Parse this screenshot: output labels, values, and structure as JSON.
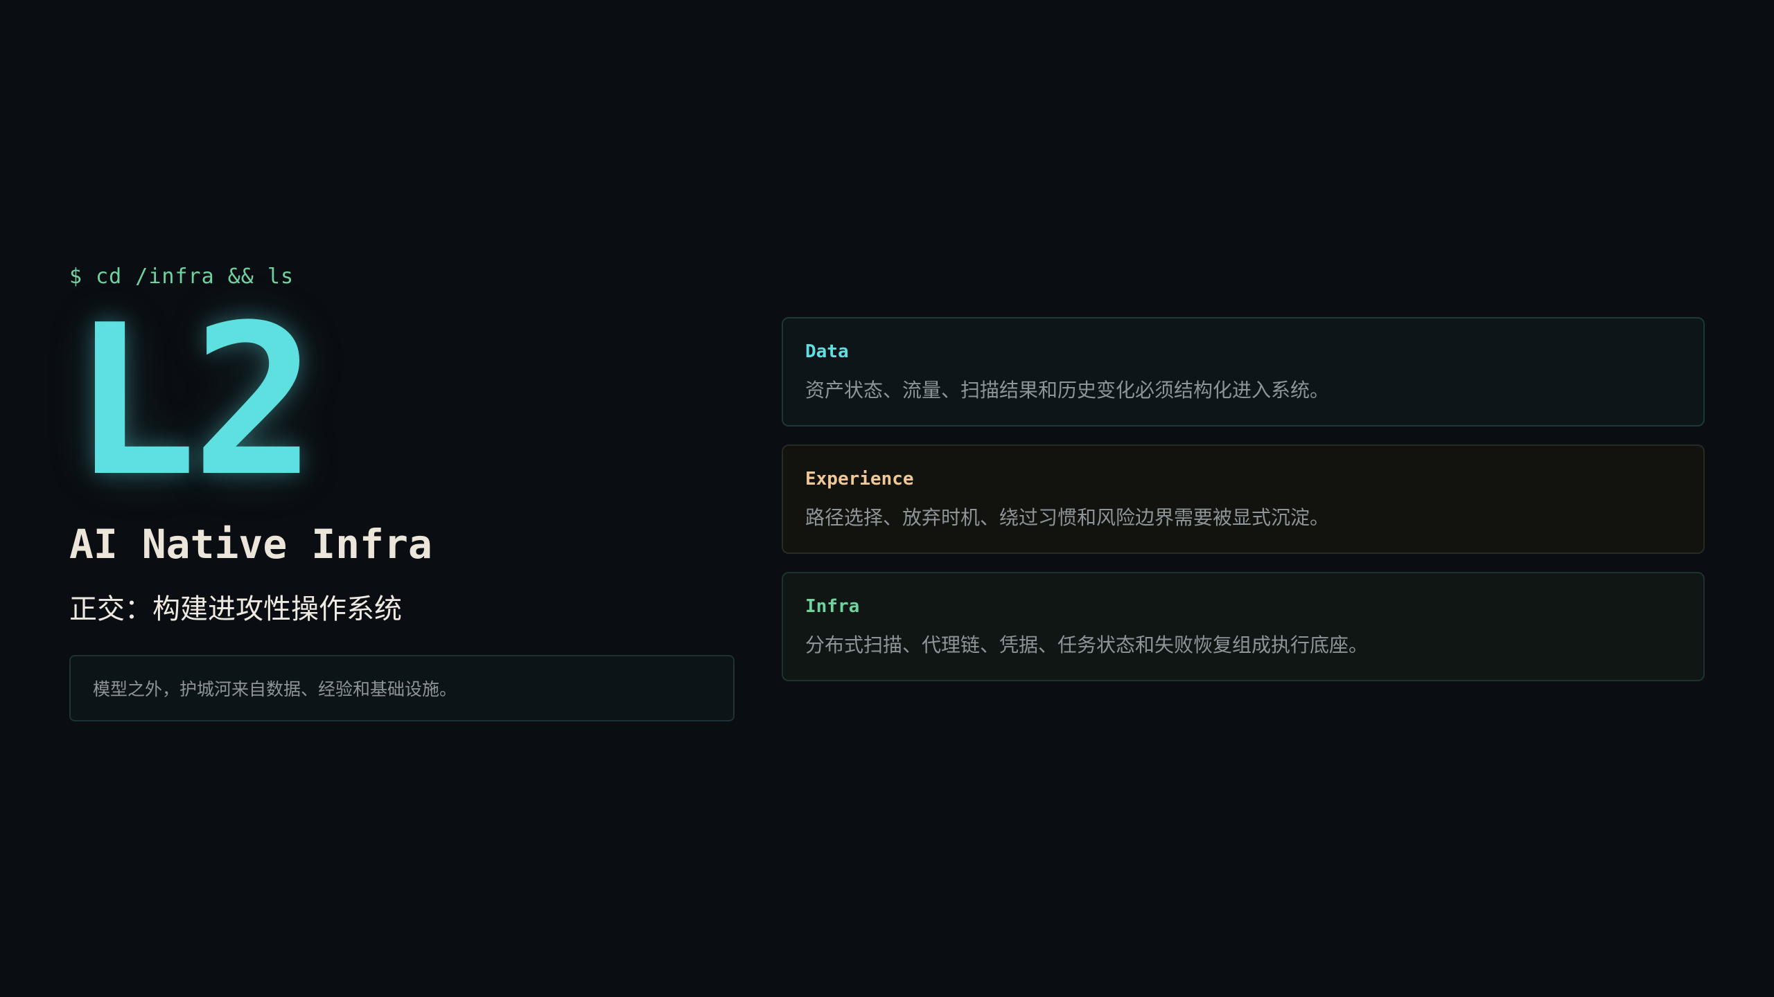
{
  "hero": {
    "prompt": "$ cd /infra && ls",
    "level": "L2",
    "title": "AI Native Infra",
    "tagline": "正交：构建进攻性操作系统",
    "note": "模型之外，护城河来自数据、经验和基础设施。"
  },
  "cards": [
    {
      "title": "Data",
      "description": "资产状态、流量、扫描结果和历史变化必须结构化进入系统。",
      "accent": "#5fe0e0"
    },
    {
      "title": "Experience",
      "description": "路径选择、放弃时机、绕过习惯和风险边界需要被显式沉淀。",
      "accent": "#f0c896"
    },
    {
      "title": "Infra",
      "description": "分布式扫描、代理链、凭据、任务状态和失败恢复组成执行底座。",
      "accent": "#6fd3a0"
    }
  ],
  "colors": {
    "background": "#0a0d11",
    "primary": "#5fe0e0",
    "green": "#6fd3a0",
    "muted": "#8e9598"
  }
}
